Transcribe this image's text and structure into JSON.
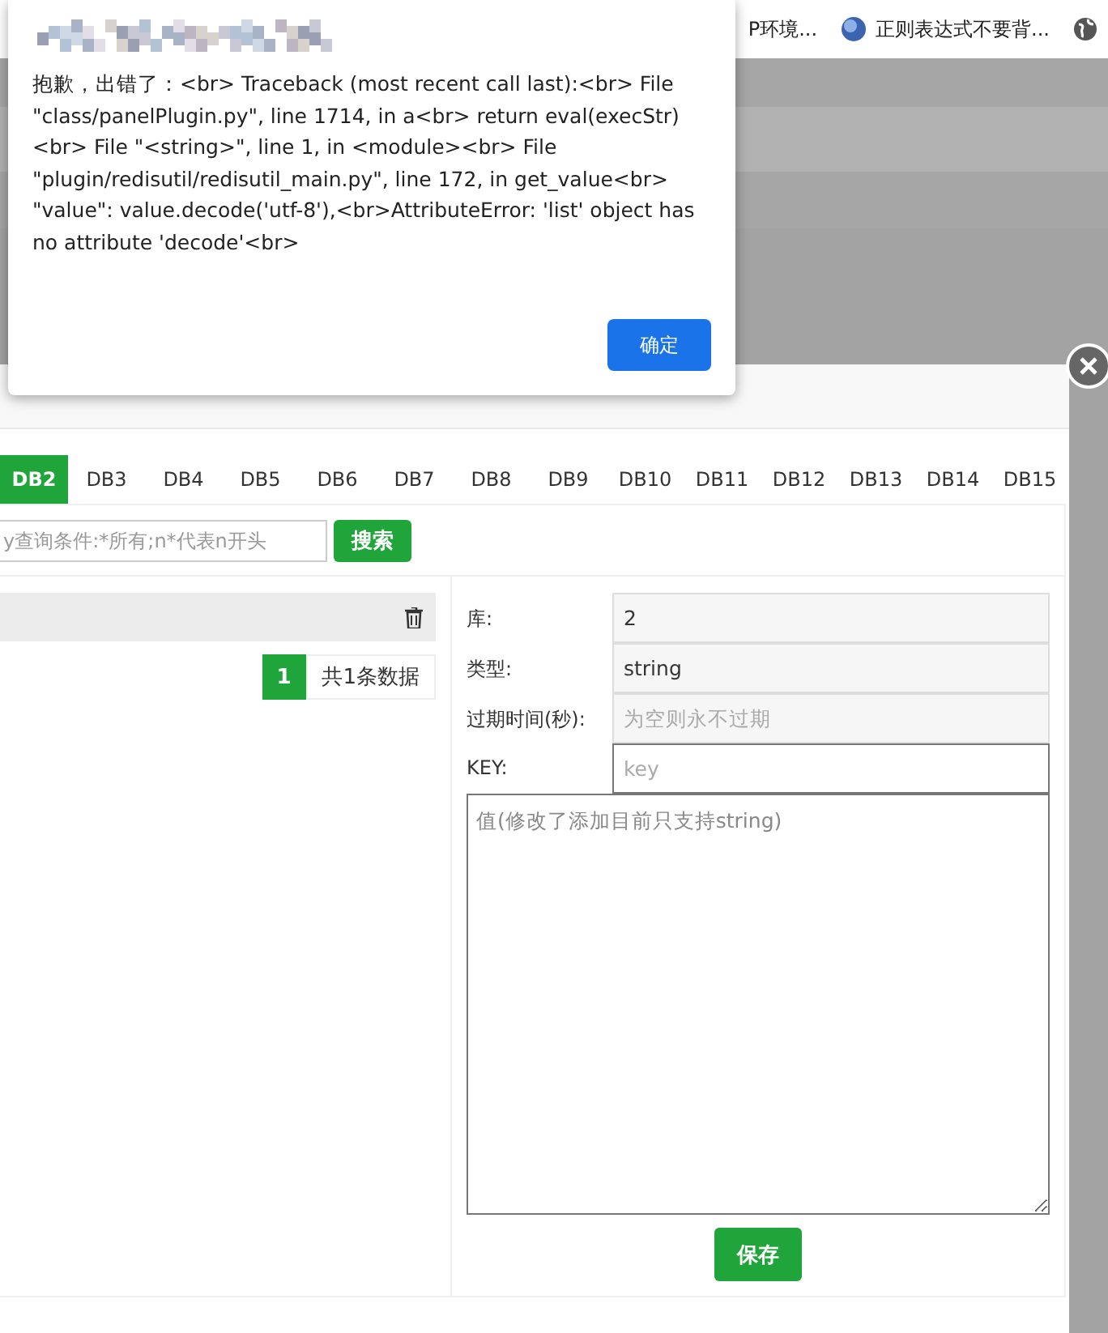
{
  "bookmarks": [
    {
      "kind": "plain",
      "label": "P环境..."
    },
    {
      "kind": "favicon",
      "label": "正则表达式不要背..."
    }
  ],
  "dialog": {
    "message": "抱歉，出错了：<br> Traceback (most recent call last):<br>   File \"class/panelPlugin.py\", line 1714, in a<br>     return eval(execStr)<br>   File \"<string>\", line 1, in <module><br>   File \"plugin/redisutil/redisutil_main.py\", line 172, in get_value<br>     \"value\": value.decode('utf-8'),<br>AttributeError: 'list' object has no attribute 'decode'<br>",
    "button": "确定"
  },
  "panel": {
    "tabs": [
      {
        "label": "DB2",
        "selected": true
      },
      {
        "label": "DB3",
        "selected": false
      },
      {
        "label": "DB4",
        "selected": false
      },
      {
        "label": "DB5",
        "selected": false
      },
      {
        "label": "DB6",
        "selected": false
      },
      {
        "label": "DB7",
        "selected": false
      },
      {
        "label": "DB8",
        "selected": false
      },
      {
        "label": "DB9",
        "selected": false
      },
      {
        "label": "DB10",
        "selected": false
      },
      {
        "label": "DB11",
        "selected": false
      },
      {
        "label": "DB12",
        "selected": false
      },
      {
        "label": "DB13",
        "selected": false
      },
      {
        "label": "DB14",
        "selected": false
      },
      {
        "label": "DB15",
        "selected": false
      }
    ],
    "search": {
      "placeholder": "y查询条件:*所有;n*代表n开头",
      "button": "搜索"
    },
    "pager": {
      "page": "1",
      "total": "共1条数据"
    },
    "fields": [
      {
        "label": "库:",
        "value": "2",
        "disabled": true
      },
      {
        "label": "类型:",
        "value": "string",
        "disabled": true
      },
      {
        "label": "过期时间(秒):",
        "placeholder": "为空则永不过期",
        "disabled": true
      },
      {
        "label": "KEY:",
        "placeholder": "key",
        "disabled": false
      }
    ],
    "value_placeholder": "值(修改了添加目前只支持string)",
    "save": "保存"
  }
}
